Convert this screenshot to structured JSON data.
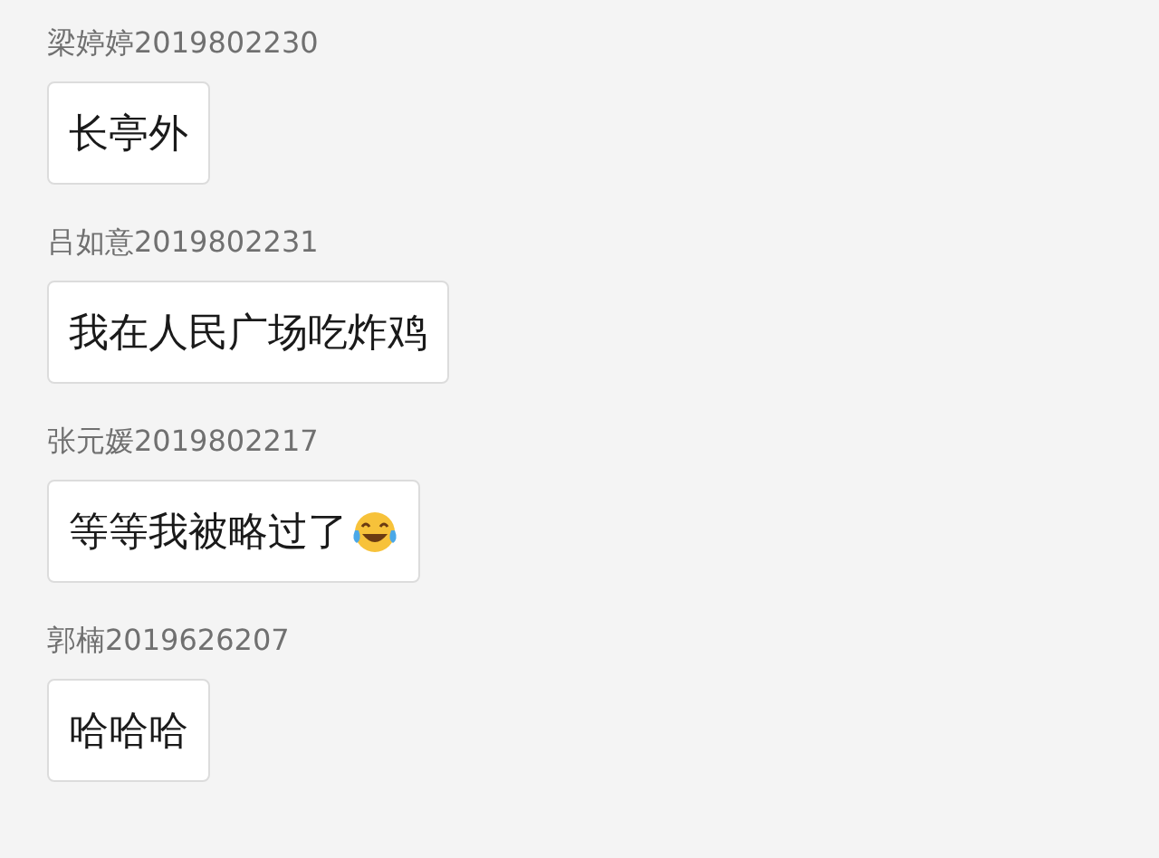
{
  "messages": [
    {
      "kind": "text",
      "sender": "梁婷婷2019802230",
      "text": "长亭外"
    },
    {
      "kind": "text",
      "sender": "吕如意2019802231",
      "text": "我在人民广场吃炸鸡"
    },
    {
      "kind": "emoji",
      "sender": "张元媛2019802217",
      "text": "等等我被略过了"
    },
    {
      "kind": "text",
      "sender": "郭楠2019626207",
      "text": "哈哈哈"
    }
  ]
}
